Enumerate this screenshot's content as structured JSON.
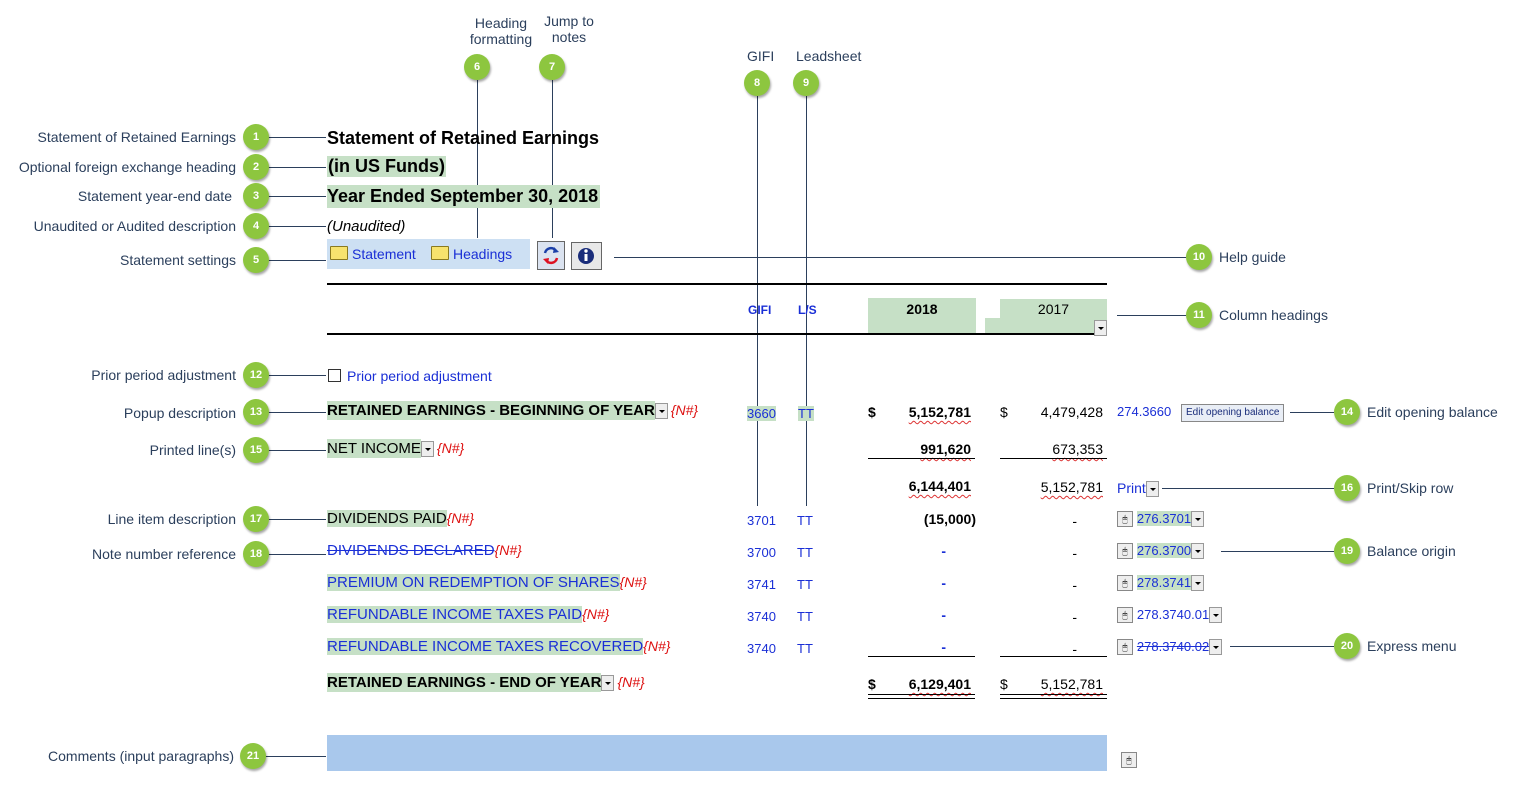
{
  "callouts": {
    "c1": "Statement of Retained Earnings",
    "c2": "Optional foreign exchange heading",
    "c3": "Statement year-end date",
    "c4": "Unaudited or Audited description",
    "c5": "Statement settings",
    "c6": "Heading formatting",
    "c7": "Jump to notes",
    "c8": "GIFI",
    "c9": "Leadsheet",
    "c10": "Help guide",
    "c11": "Column headings",
    "c12": "Prior period adjustment",
    "c13": "Popup description",
    "c14": "Edit opening balance",
    "c15": "Printed line(s)",
    "c16": "Print/Skip row",
    "c17": "Line item description",
    "c18": "Note number reference",
    "c19": "Balance origin",
    "c20": "Express menu",
    "c21": "Comments (input paragraphs)"
  },
  "badges": [
    "1",
    "2",
    "3",
    "4",
    "5",
    "6",
    "7",
    "8",
    "9",
    "10",
    "11",
    "12",
    "13",
    "14",
    "15",
    "16",
    "17",
    "18",
    "19",
    "20",
    "21"
  ],
  "heading": {
    "title": "Statement of Retained Earnings",
    "currency": "(in US Funds)",
    "year_end": "Year Ended September 30, 2018",
    "audit": "(Unaudited)"
  },
  "settings": {
    "statement": "Statement",
    "headings": "Headings"
  },
  "columns": {
    "gifi": "GIFI",
    "ls": "L/S",
    "year1": "2018",
    "year2": "2017"
  },
  "prior_period_label": "Prior period adjustment",
  "note_ref": "{N#}",
  "rows": {
    "beginning": {
      "desc": "RETAINED EARNINGS - BEGINNING OF YEAR",
      "gifi": "3660",
      "ls": "TT",
      "cur": "$",
      "v1": "5,152,781",
      "v2": "4,479,428",
      "origin": "274.3660",
      "edit_btn": "Edit opening balance"
    },
    "net_income": {
      "desc": "NET INCOME",
      "v1": "991,620",
      "v2": "673,353"
    },
    "subtotal": {
      "v1": "6,144,401",
      "v2": "5,152,781",
      "print": "Print"
    },
    "dividends_paid": {
      "desc": "DIVIDENDS PAID",
      "gifi": "3701",
      "ls": "TT",
      "v1": "(15,000)",
      "v2": "-",
      "origin": "276.3701"
    },
    "dividends_declared": {
      "desc": "DIVIDENDS DECLARED",
      "gifi": "3700",
      "ls": "TT",
      "v1": "-",
      "v2": "-",
      "origin": "276.3700"
    },
    "premium": {
      "desc": "PREMIUM ON REDEMPTION OF SHARES",
      "gifi": "3741",
      "ls": "TT",
      "v1": "-",
      "v2": "-",
      "origin": "278.3741"
    },
    "ref_paid": {
      "desc": "REFUNDABLE INCOME TAXES PAID",
      "gifi": "3740",
      "ls": "TT",
      "v1": "-",
      "v2": "-",
      "origin": "278.3740.01"
    },
    "ref_recovered": {
      "desc": "REFUNDABLE INCOME TAXES RECOVERED",
      "gifi": "3740",
      "ls": "TT",
      "v1": "-",
      "v2": "-",
      "origin": "278.3740.02"
    },
    "ending": {
      "desc": "RETAINED EARNINGS - END OF YEAR",
      "cur": "$",
      "v1": "6,129,401",
      "v2": "5,152,781"
    }
  },
  "colors": {
    "accent_badge": "#8dc63f",
    "row_highlight": "#c6e0c6",
    "comment_box": "#a9c8ec",
    "link_blue": "#1a2fd6",
    "note_red": "#dd1111"
  }
}
